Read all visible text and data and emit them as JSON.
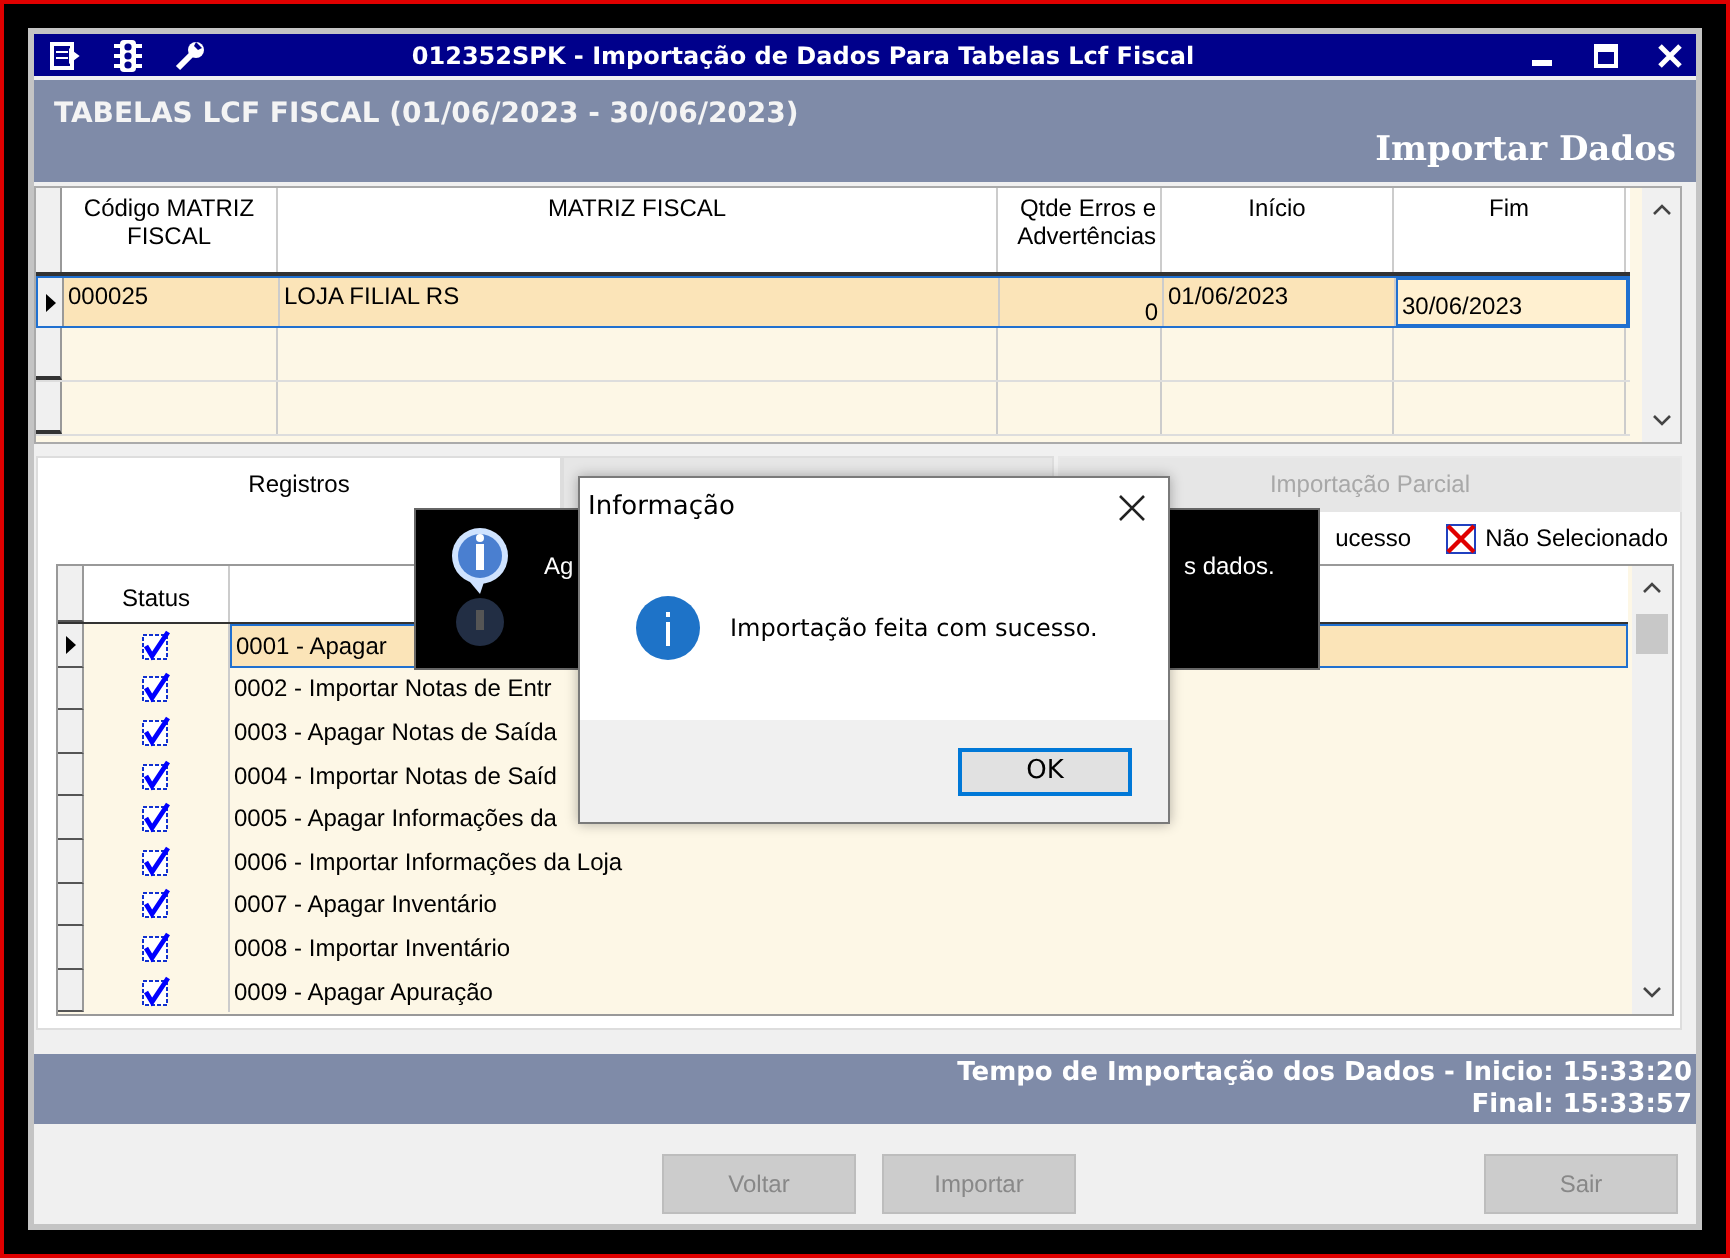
{
  "window": {
    "title": "012352SPK - Importação de Dados Para Tabelas Lcf Fiscal"
  },
  "header": {
    "title": "TABELAS LCF FISCAL (01/06/2023 - 30/06/2023)",
    "subtitle": "Importar Dados"
  },
  "matrix_table": {
    "columns": [
      "Código MATRIZ FISCAL",
      "MATRIZ FISCAL",
      "Qtde Erros e Advertências",
      "Início",
      "Fim"
    ],
    "rows": [
      {
        "selected": true,
        "cells": [
          "000025",
          "LOJA FILIAL RS",
          "0",
          "01/06/2023",
          "30/06/2023"
        ]
      }
    ]
  },
  "tabs": [
    {
      "label": "Registros",
      "selected": true,
      "disabled": false
    },
    {
      "selected": false
    },
    {
      "label": "Importação Parcial",
      "selected": false,
      "disabled": true
    }
  ],
  "legend": [
    {
      "kind": "text",
      "label": "ucesso"
    },
    {
      "kind": "x-mark",
      "label": "Não Selecionado"
    }
  ],
  "records_table": {
    "columns": [
      "Status"
    ],
    "rows": [
      {
        "selected": true,
        "checked": true,
        "label": "0001 - Apagar"
      },
      {
        "selected": false,
        "checked": true,
        "label": "0002 - Importar Notas de Entr"
      },
      {
        "selected": false,
        "checked": true,
        "label": "0003 - Apagar Notas de Saída"
      },
      {
        "selected": false,
        "checked": true,
        "label": "0004 - Importar Notas de Saíd"
      },
      {
        "selected": false,
        "checked": true,
        "label": "0005 - Apagar Informações da"
      },
      {
        "selected": false,
        "checked": true,
        "label": "0006 - Importar Informações da Loja"
      },
      {
        "selected": false,
        "checked": true,
        "label": "0007 - Apagar Inventário"
      },
      {
        "selected": false,
        "checked": true,
        "label": "0008 - Importar Inventário"
      },
      {
        "selected": false,
        "checked": true,
        "label": "0009 - Apagar Apuração"
      }
    ]
  },
  "status": {
    "line_1": "Tempo de Importação dos Dados - Inicio: 15:33:20",
    "line_2": "Final: 15:33:57"
  },
  "buttons": [
    {
      "label": "Voltar",
      "disabled": true
    },
    {
      "label": "Importar",
      "disabled": true
    },
    {
      "label": "Sair",
      "disabled": true
    }
  ],
  "toast": {
    "text_left": "Ag",
    "text_right": "s dados."
  },
  "dialog": {
    "title": "Informação",
    "message": "Importação feita com sucesso.",
    "button": "OK"
  }
}
